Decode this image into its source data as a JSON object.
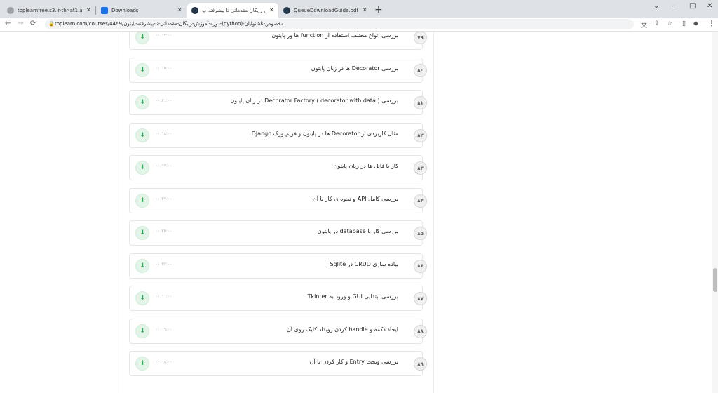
{
  "browser": {
    "tabs": [
      {
        "title": "toplearnfree.s3.ir-thr-at1.arvanst",
        "active": false
      },
      {
        "title": "Downloads",
        "active": false
      },
      {
        "title": "آموزش رایگان مقدماتی تا پیشرفته پ",
        "active": true
      },
      {
        "title": "QueueDownloadGuide.pdf",
        "active": false
      }
    ],
    "new_tab": "+",
    "window_controls": {
      "minimize": "–",
      "maximize": "□",
      "close": "✕"
    },
    "url_host": "toplearn.com",
    "url_path": "/courses/4469/دوره-آموزش-رایگان-مقدماتی-تا-پیشرفته-پایتون-(python)-مخصوص-ناشنوایان",
    "nav": {
      "back": "←",
      "forward": "→",
      "reload": "⟳"
    }
  },
  "lessons": [
    {
      "num": "۷۹",
      "title": "بررسی انواع مختلف استفاده از function ها ور پایتون",
      "duration": "۰۰:۱۳:۰۰"
    },
    {
      "num": "۸۰",
      "title": "بررسی Decorator ها در زبان پایتون",
      "duration": "۰۰:۱۵:۰۰"
    },
    {
      "num": "۸۱",
      "title": "بررسی ( Decorator Factory ( decorator with data در زبان پایتون",
      "duration": "۰۰:۲۱:۰۰"
    },
    {
      "num": "۸۲",
      "title": "مثال کاربردی از Decorator ها در پایتون و فریم ورک DJango",
      "duration": "۰۰:۱۸:۰۰"
    },
    {
      "num": "۸۳",
      "title": "کار با فایل ها در زبان پایتون",
      "duration": "۰۰:۱۷:۰۰"
    },
    {
      "num": "۸۴",
      "title": "بررسی کامل API و نحوه ی کار با آن",
      "duration": "۰۰:۲۷:۰۰"
    },
    {
      "num": "۸۵",
      "title": "بررسی کار با database در پایتون",
      "duration": "۰۰:۲۵:۰۰"
    },
    {
      "num": "۸۶",
      "title": "پیاده سازی CRUD در Sqlite",
      "duration": "۰۰:۲۲:۰۰"
    },
    {
      "num": "۸۷",
      "title": "بررسی ابتدایی GUI و ورود به Tkinter",
      "duration": "۰۰:۱۱:۰۰"
    },
    {
      "num": "۸۸",
      "title": "ایجاد دکمه و handle کردن رویداد کلیک روی آن",
      "duration": "۰۰:۰۹:۰۰"
    },
    {
      "num": "۸۹",
      "title": "بررسی ویجت Entry و کار کردن با آن",
      "duration": "۰۰:۰۸:۰۰"
    }
  ],
  "colors": {
    "accent_green": "#2faa55",
    "tab_bar": "#dee1e6"
  }
}
